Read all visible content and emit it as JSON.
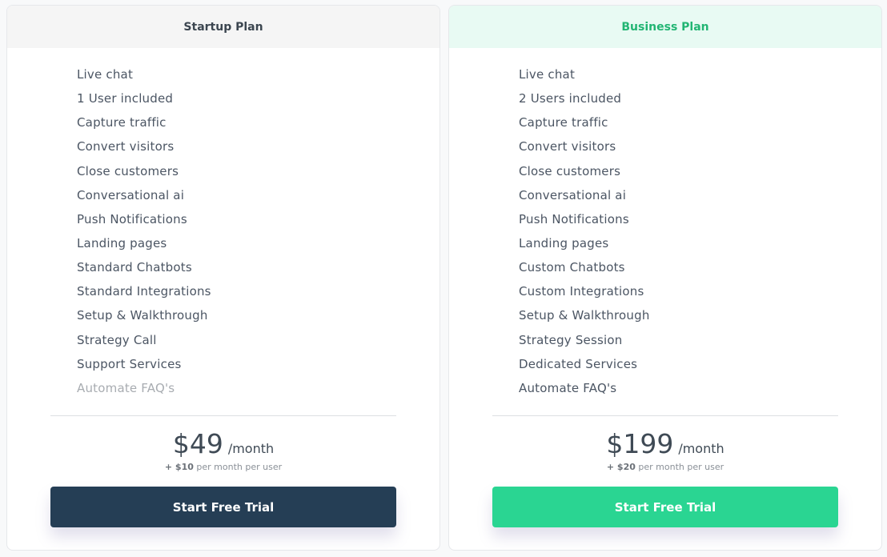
{
  "plans": [
    {
      "name": "Startup Plan",
      "features": [
        {
          "label": "Live chat",
          "included": true
        },
        {
          "label": "1 User included",
          "included": true
        },
        {
          "label": "Capture traffic",
          "included": true
        },
        {
          "label": "Convert visitors",
          "included": true
        },
        {
          "label": "Close customers",
          "included": true
        },
        {
          "label": "Conversational ai",
          "included": true
        },
        {
          "label": "Push Notifications",
          "included": true
        },
        {
          "label": "Landing pages",
          "included": true
        },
        {
          "label": "Standard Chatbots",
          "included": true
        },
        {
          "label": "Standard Integrations",
          "included": true
        },
        {
          "label": "Setup & Walkthrough",
          "included": true
        },
        {
          "label": "Strategy Call",
          "included": true
        },
        {
          "label": "Support Services",
          "included": true
        },
        {
          "label": "Automate FAQ's",
          "included": false
        }
      ],
      "price": "$49",
      "period": "/month",
      "extra_amount": "+ $10",
      "extra_text": "per month per user",
      "cta_label": "Start Free Trial"
    },
    {
      "name": "Business Plan",
      "features": [
        {
          "label": "Live chat",
          "included": true
        },
        {
          "label": "2 Users included",
          "included": true
        },
        {
          "label": "Capture traffic",
          "included": true
        },
        {
          "label": "Convert visitors",
          "included": true
        },
        {
          "label": "Close customers",
          "included": true
        },
        {
          "label": "Conversational ai",
          "included": true
        },
        {
          "label": "Push Notifications",
          "included": true
        },
        {
          "label": "Landing pages",
          "included": true
        },
        {
          "label": "Custom Chatbots",
          "included": true
        },
        {
          "label": "Custom Integrations",
          "included": true
        },
        {
          "label": "Setup & Walkthrough",
          "included": true
        },
        {
          "label": "Strategy Session",
          "included": true
        },
        {
          "label": "Dedicated Services",
          "included": true
        },
        {
          "label": "Automate FAQ's",
          "included": true
        }
      ],
      "price": "$199",
      "period": "/month",
      "extra_amount": "+ $20",
      "extra_text": "per month per user",
      "cta_label": "Start Free Trial"
    }
  ],
  "colors": {
    "startup_cta": "#253e55",
    "business_cta": "#2ad592",
    "business_accent": "#22b573",
    "business_header_bg": "#e8faf3"
  }
}
